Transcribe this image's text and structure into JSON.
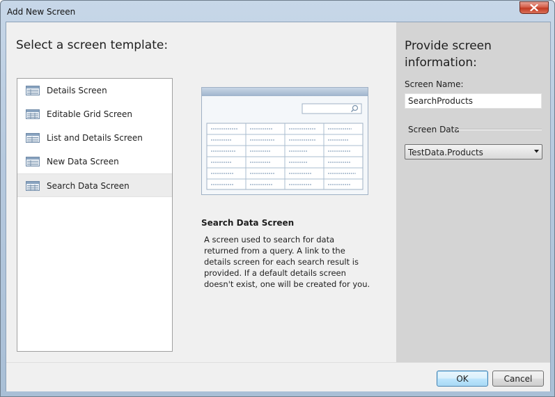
{
  "window": {
    "title": "Add New Screen"
  },
  "left": {
    "heading": "Select a screen template:",
    "templates": [
      {
        "label": "Details Screen",
        "selected": false
      },
      {
        "label": "Editable Grid Screen",
        "selected": false
      },
      {
        "label": "List and Details Screen",
        "selected": false
      },
      {
        "label": "New Data Screen",
        "selected": false
      },
      {
        "label": "Search Data Screen",
        "selected": true
      }
    ]
  },
  "preview": {
    "title": "Search Data Screen",
    "description": "A screen used to search for data returned from a query.  A link to the details screen for each search result is provided.  If a default details screen doesn't exist, one will be created for you."
  },
  "right": {
    "heading": "Provide screen information:",
    "screen_name_label": "Screen Name:",
    "screen_name_value": "SearchProducts",
    "screen_data_label": "Screen Data",
    "screen_data_value": "TestData.Products"
  },
  "footer": {
    "ok_label": "OK",
    "cancel_label": "Cancel"
  },
  "colors": {
    "accent": "#3c7fb1",
    "close_button": "#c23b22",
    "right_pane": "#d4d4d4"
  },
  "icons": {
    "close": "close-icon",
    "template": "screen-template-icon",
    "search": "search-icon",
    "dropdown": "chevron-down-icon"
  }
}
